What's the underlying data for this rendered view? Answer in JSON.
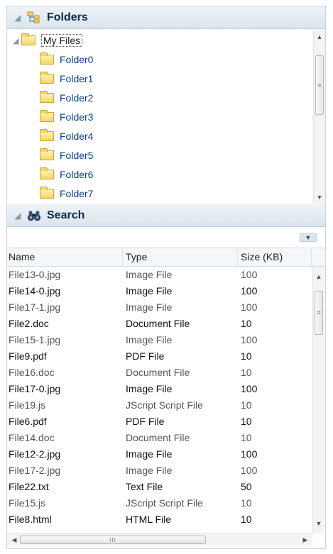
{
  "folders_panel": {
    "title": "Folders",
    "root_label": "My Files",
    "items": [
      "Folder0",
      "Folder1",
      "Folder2",
      "Folder3",
      "Folder4",
      "Folder5",
      "Folder6",
      "Folder7"
    ]
  },
  "search_panel": {
    "title": "Search",
    "columns": [
      "Name",
      "Type",
      "Size (KB)"
    ],
    "rows": [
      {
        "name": "File13-0.jpg",
        "type": "Image File",
        "size": "100"
      },
      {
        "name": "File14-0.jpg",
        "type": "Image File",
        "size": "100"
      },
      {
        "name": "File17-1.jpg",
        "type": "Image File",
        "size": "100"
      },
      {
        "name": "File2.doc",
        "type": "Document File",
        "size": "10"
      },
      {
        "name": "File15-1.jpg",
        "type": "Image File",
        "size": "100"
      },
      {
        "name": "File9.pdf",
        "type": "PDF File",
        "size": "10"
      },
      {
        "name": "File16.doc",
        "type": "Document File",
        "size": "10"
      },
      {
        "name": "File17-0.jpg",
        "type": "Image File",
        "size": "100"
      },
      {
        "name": "File19.js",
        "type": "JScript Script File",
        "size": "10"
      },
      {
        "name": "File6.pdf",
        "type": "PDF File",
        "size": "10"
      },
      {
        "name": "File14.doc",
        "type": "Document File",
        "size": "10"
      },
      {
        "name": "File12-2.jpg",
        "type": "Image File",
        "size": "100"
      },
      {
        "name": "File17-2.jpg",
        "type": "Image File",
        "size": "100"
      },
      {
        "name": "File22.txt",
        "type": "Text File",
        "size": "50"
      },
      {
        "name": "File15.js",
        "type": "JScript Script File",
        "size": "10"
      },
      {
        "name": "File8.html",
        "type": "HTML File",
        "size": "10"
      }
    ]
  },
  "icons": {
    "folders_header": "folder-tree-icon",
    "search_header": "binoculars-icon",
    "folder": "folder-icon"
  },
  "colors": {
    "header_bg": "#dbe5ee",
    "link_blue": "#0b3f8e"
  }
}
